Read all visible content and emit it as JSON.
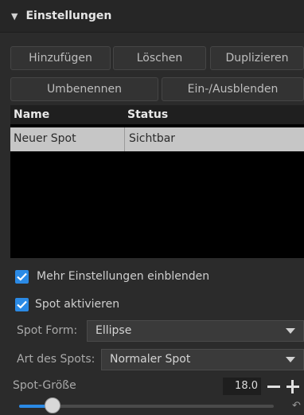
{
  "panel": {
    "title": "Einstellungen"
  },
  "buttons": {
    "add": "Hinzufügen",
    "delete": "Löschen",
    "duplicate": "Duplizieren",
    "rename": "Umbenennen",
    "toggle_visibility": "Ein-/Ausblenden"
  },
  "table": {
    "columns": [
      "Name",
      "Status"
    ],
    "rows": [
      {
        "name": "Neuer Spot",
        "status": "Sichtbar"
      }
    ]
  },
  "options": {
    "more_settings": {
      "label": "Mehr Einstellungen einblenden",
      "checked": true
    },
    "spot_active": {
      "label": "Spot aktivieren",
      "checked": true
    }
  },
  "fields": {
    "spot_form": {
      "label": "Spot Form:",
      "value": "Ellipse"
    },
    "spot_type": {
      "label": "Art des Spots:",
      "value": "Normaler Spot"
    }
  },
  "spot_size": {
    "label": "Spot-Größe",
    "value": "18.0"
  },
  "colors": {
    "accent": "#2b8ae5",
    "selected_row": "#c6c6c6"
  }
}
